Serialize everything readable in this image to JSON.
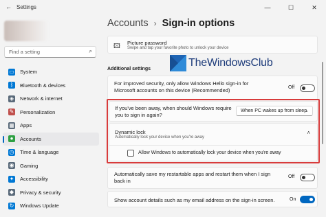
{
  "window": {
    "title": "Settings"
  },
  "search": {
    "placeholder": "Find a setting"
  },
  "sidebar": {
    "items": [
      {
        "label": "System",
        "icon": "monitor-icon",
        "color": "#0078d4"
      },
      {
        "label": "Bluetooth & devices",
        "icon": "bluetooth-icon",
        "color": "#0078d4"
      },
      {
        "label": "Network & internet",
        "icon": "wifi-icon",
        "color": "#5a6a7a"
      },
      {
        "label": "Personalization",
        "icon": "brush-icon",
        "color": "#c0504d"
      },
      {
        "label": "Apps",
        "icon": "apps-icon",
        "color": "#5a6a7a"
      },
      {
        "label": "Accounts",
        "icon": "person-icon",
        "color": "#2ea043",
        "active": true
      },
      {
        "label": "Time & language",
        "icon": "globe-clock-icon",
        "color": "#0078d4"
      },
      {
        "label": "Gaming",
        "icon": "controller-icon",
        "color": "#5a6a7a"
      },
      {
        "label": "Accessibility",
        "icon": "accessibility-icon",
        "color": "#0078d4"
      },
      {
        "label": "Privacy & security",
        "icon": "shield-icon",
        "color": "#5a6a7a"
      },
      {
        "label": "Windows Update",
        "icon": "update-icon",
        "color": "#0078d4"
      }
    ]
  },
  "breadcrumb": {
    "parent": "Accounts",
    "separator": "›",
    "current": "Sign-in options"
  },
  "picture_password": {
    "title": "Picture password",
    "subtitle": "Swipe and tap your favorite photo to unlock your device"
  },
  "additional_settings": {
    "heading": "Additional settings",
    "hello_only": {
      "text": "For improved security, only allow Windows Hello sign-in for Microsoft accounts on this device (Recommended)",
      "state_label": "Off"
    },
    "away": {
      "text": "If you've been away, when should Windows require you to sign in again?",
      "selected": "When PC wakes up from sleep"
    },
    "dynamic_lock": {
      "title": "Dynamic lock",
      "subtitle": "Automatically lock your device when you're away",
      "checkbox_label": "Allow Windows to automatically lock your device when you're away"
    },
    "restart_apps": {
      "text": "Automatically save my restartable apps and restart them when I sign back in",
      "state_label": "Off"
    },
    "show_account": {
      "text": "Show account details such as my email address on the sign-in screen.",
      "state_label": "On"
    }
  },
  "watermark": {
    "text": "TheWindowsClub"
  },
  "colors": {
    "accent": "#0067c0",
    "highlight_border": "#d83b3b"
  }
}
